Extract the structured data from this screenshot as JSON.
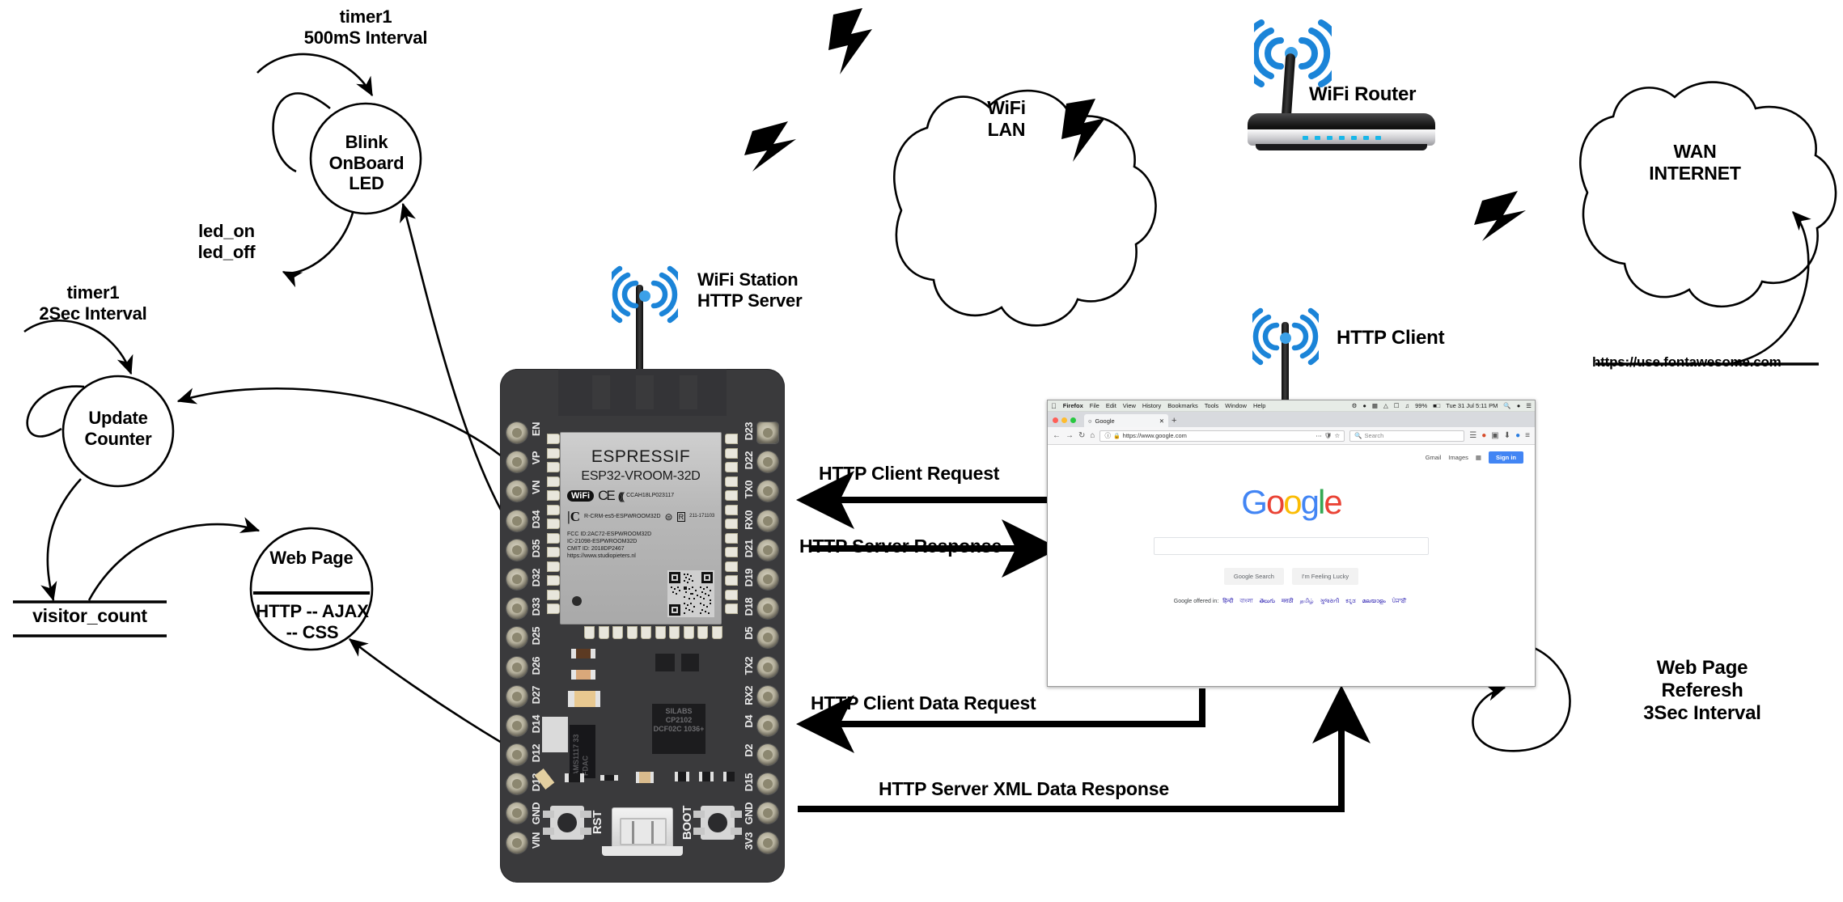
{
  "nodes": {
    "blink_led": "Blink\nOnBoard\nLED",
    "update_counter": "Update\nCounter",
    "web_page_title": "Web Page",
    "web_page_body": "HTTP -- AJAX\n-- CSS",
    "visitor_count": "visitor_count",
    "wifi_lan": "WiFi\nLAN",
    "wan_internet": "WAN\nINTERNET"
  },
  "labels": {
    "timer1_500ms": "timer1\n500mS Interval",
    "led_on_off": "led_on\nled_off",
    "timer1_2sec": "timer1\n2Sec Interval",
    "wifi_station_http_server": "WiFi Station\nHTTP Server",
    "wifi_router": "WiFi Router",
    "http_client": "HTTP Client",
    "fontawesome_url": "https://use.fontawesome.com",
    "web_page_refresh": "Web Page\nReferesh\n3Sec Interval"
  },
  "flows": {
    "http_client_request": "HTTP Client Request",
    "http_server_response": "HTTP Server Response",
    "http_client_data_request": "HTTP Client Data Request",
    "http_server_xml_data_response": "HTTP Server XML Data Response"
  },
  "esp32": {
    "module_brand": "ESPRESSIF",
    "module_part": "ESP32-VROOM-32D",
    "wifi_badge": "WiFi",
    "ce_mark": "CE",
    "cert_code": "CCAH18LP023117",
    "kc_code": "R-CRM-es5-ESPWROOM32D",
    "mic_code": "211-171103",
    "fcc_line1": "FCC ID:2AC72-ESPWROOM32D",
    "fcc_line2": "IC-21098-ESPWROOM32D",
    "fcc_line3": "CMIT ID: 2018DP2467",
    "fcc_line4": "https://www.studiopieters.nl",
    "silabs": "SILABS\nCP2102\nDCF02C\n1036+",
    "regulator": "AMS1117\n33 FDAC",
    "btn_rst": "RST",
    "btn_boot": "BOOT",
    "pins_left": [
      "EN",
      "VP",
      "VN",
      "D34",
      "D35",
      "D32",
      "D33",
      "D25",
      "D26",
      "D27",
      "D14",
      "D12",
      "D13",
      "GND",
      "VIN"
    ],
    "pins_right": [
      "D23",
      "D22",
      "TX0",
      "RX0",
      "D21",
      "D19",
      "D18",
      "D5",
      "TX2",
      "RX2",
      "D4",
      "D2",
      "D15",
      "GND",
      "3V3"
    ]
  },
  "browser": {
    "os_menu": [
      "Firefox",
      "File",
      "Edit",
      "View",
      "History",
      "Bookmarks",
      "Tools",
      "Window",
      "Help"
    ],
    "status_time": "Tue 31 Jul  5:11 PM",
    "battery": "99%",
    "tab_title": "Google",
    "url": "https://www.google.com",
    "search_placeholder": "Search",
    "google_logo": "Google",
    "top_links": [
      "Gmail",
      "Images"
    ],
    "sign_in": "Sign in",
    "btn_search": "Google Search",
    "btn_lucky": "I'm Feeling Lucky",
    "langs_prefix": "Google offered in:",
    "langs": [
      "हिन्दी",
      "বাংলা",
      "తెలుగు",
      "मराठी",
      "தமிழ்",
      "ગુજરાતી",
      "ಕನ್ನಡ",
      "മലയാളം",
      "ਪੰਜਾਬੀ"
    ]
  },
  "colors": {
    "stroke": "#000000",
    "board": "#3a3a3c",
    "wifi_blue": "#1b84d8",
    "link_blue": "#1a0dab"
  }
}
